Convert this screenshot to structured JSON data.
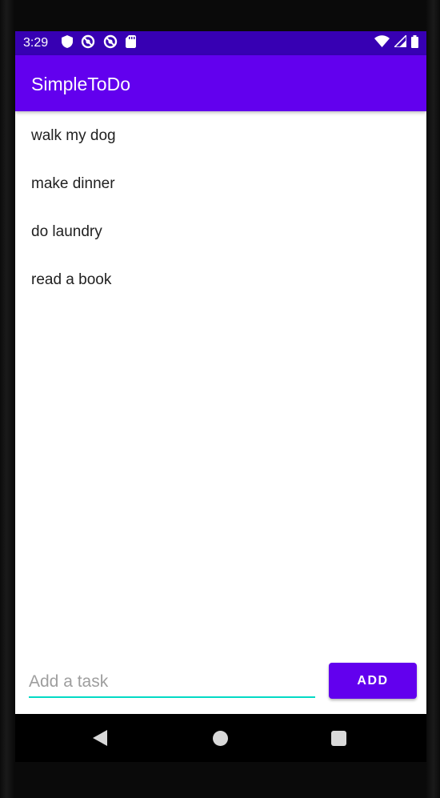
{
  "status_bar": {
    "time": "3:29",
    "background_color": "#3700b3",
    "left_icons": [
      "shield-icon",
      "do-not-disturb-icon",
      "do-not-disturb-icon",
      "sd-card-icon"
    ],
    "right_icons": [
      "wifi-icon",
      "cell-signal-icon",
      "battery-icon"
    ]
  },
  "app_bar": {
    "title": "SimpleToDo",
    "color": "#6200ee"
  },
  "tasks": [
    {
      "label": "walk my dog"
    },
    {
      "label": "make dinner"
    },
    {
      "label": "do laundry"
    },
    {
      "label": "read a book"
    }
  ],
  "input": {
    "placeholder": "Add a task",
    "value": "",
    "underline_color": "#03dac5"
  },
  "add_button": {
    "label": "ADD",
    "color": "#6200ee"
  },
  "nav_bar": {
    "buttons": [
      "back-icon",
      "home-icon",
      "recents-icon"
    ]
  }
}
